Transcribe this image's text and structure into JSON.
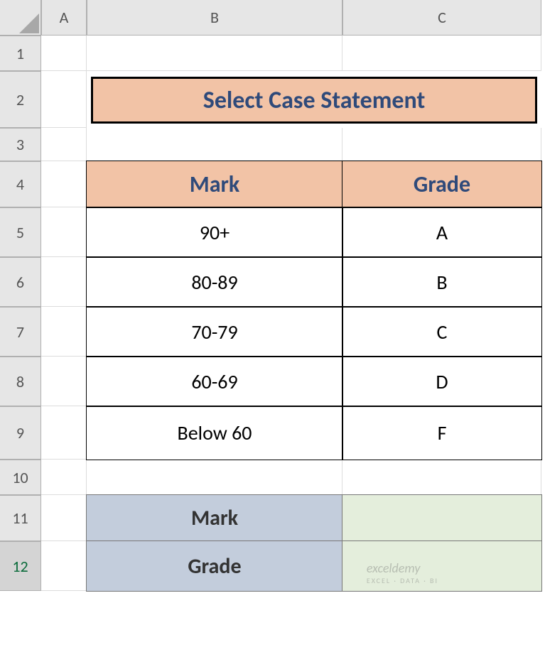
{
  "columns": [
    "A",
    "B",
    "C"
  ],
  "rows": [
    "1",
    "2",
    "3",
    "4",
    "5",
    "6",
    "7",
    "8",
    "9",
    "10",
    "11",
    "12"
  ],
  "title": "Select Case Statement",
  "table1": {
    "headers": {
      "mark": "Mark",
      "grade": "Grade"
    },
    "rows": [
      {
        "mark": "90+",
        "grade": "A"
      },
      {
        "mark": "80-89",
        "grade": "B"
      },
      {
        "mark": "70-79",
        "grade": "C"
      },
      {
        "mark": "60-69",
        "grade": "D"
      },
      {
        "mark": "Below 60",
        "grade": "F"
      }
    ]
  },
  "table2": {
    "markLabel": "Mark",
    "gradeLabel": "Grade",
    "markValue": "",
    "gradeValue": ""
  },
  "watermark": {
    "brand": "exceldemy",
    "tag": "EXCEL · DATA · BI"
  }
}
